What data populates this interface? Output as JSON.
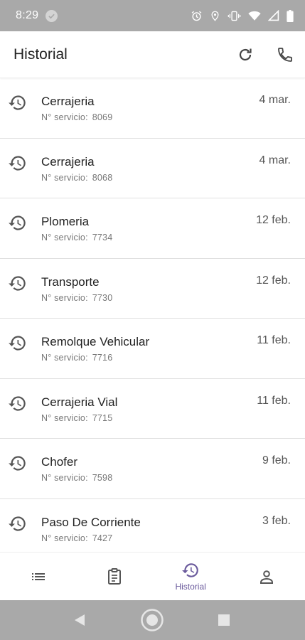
{
  "status_bar": {
    "time": "8:29",
    "icons": [
      "check-circle-icon",
      "alarm-icon",
      "location-icon",
      "vibrate-icon",
      "wifi-icon",
      "signal-icon",
      "battery-icon"
    ]
  },
  "app_bar": {
    "title": "Historial",
    "actions": [
      "refresh-icon",
      "phone-icon"
    ]
  },
  "services": [
    {
      "title": "Cerrajeria",
      "sub_label": "N° servicio:",
      "number": "8069",
      "date": "4 mar."
    },
    {
      "title": "Cerrajeria",
      "sub_label": "N° servicio:",
      "number": "8068",
      "date": "4 mar."
    },
    {
      "title": "Plomeria",
      "sub_label": "N° servicio:",
      "number": "7734",
      "date": "12 feb."
    },
    {
      "title": "Transporte",
      "sub_label": "N° servicio:",
      "number": "7730",
      "date": "12 feb."
    },
    {
      "title": "Remolque Vehicular",
      "sub_label": "N° servicio:",
      "number": "7716",
      "date": "11 feb."
    },
    {
      "title": "Cerrajeria Vial",
      "sub_label": "N° servicio:",
      "number": "7715",
      "date": "11 feb."
    },
    {
      "title": "Chofer",
      "sub_label": "N° servicio:",
      "number": "7598",
      "date": "9 feb."
    },
    {
      "title": "Paso De Corriente",
      "sub_label": "N° servicio:",
      "number": "7427",
      "date": "3 feb."
    }
  ],
  "bottom_nav": {
    "items": [
      {
        "icon": "list-icon",
        "label": ""
      },
      {
        "icon": "clipboard-icon",
        "label": ""
      },
      {
        "icon": "history-icon",
        "label": "Historial",
        "active": true
      },
      {
        "icon": "user-icon",
        "label": ""
      }
    ],
    "active_color": "#6a5a9c"
  },
  "colors": {
    "status_bar": "#a9a9a9",
    "accent": "#6a5a9c",
    "divider": "#e0e0e0"
  }
}
